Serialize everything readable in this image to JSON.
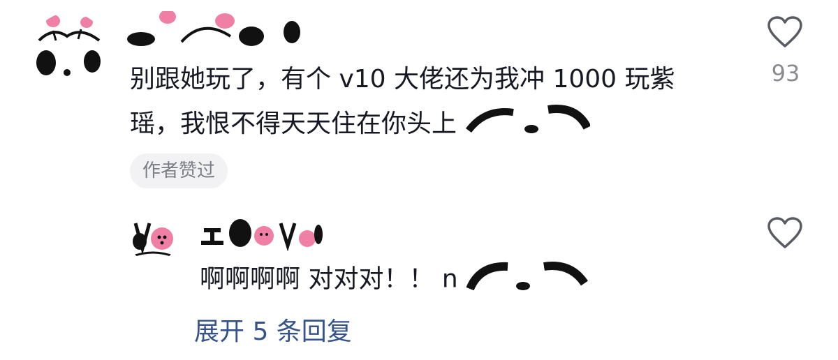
{
  "comment": {
    "text_line1": "别跟她玩了，有个 v10 大佬还为我冲 1000 玩紫",
    "text_line2": "瑶，我恨不得天天住在你头上",
    "author_badge": "作者赞过",
    "like_count": "93",
    "like_icon": "heart-outline-icon"
  },
  "reply": {
    "text": "啊啊啊啊  对对对！！ n",
    "like_icon": "heart-outline-icon"
  },
  "expand_replies": {
    "label": "展开 5 条回复"
  },
  "colors": {
    "text": "#161823",
    "muted": "#8a8b91",
    "link": "#35538a",
    "badge_bg": "#f2f2f4",
    "panda_pink": "#f07fa6"
  }
}
